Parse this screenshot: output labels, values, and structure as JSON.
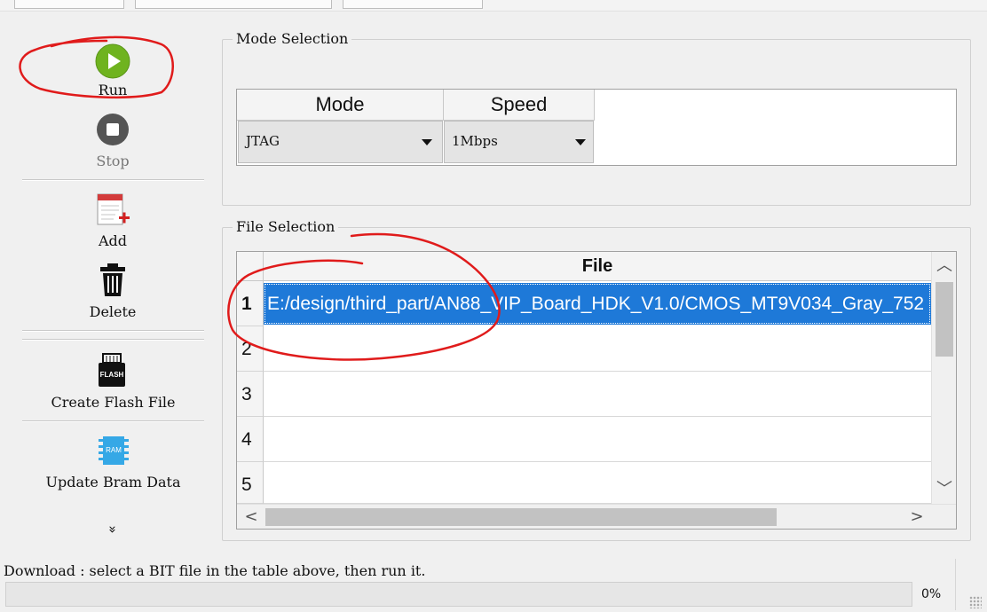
{
  "toolbar": {
    "run_label": "Run",
    "stop_label": "Stop",
    "add_label": "Add",
    "delete_label": "Delete",
    "create_flash_label": "Create Flash File",
    "flash_icon_text": "FLASH",
    "update_bram_label": "Update Bram Data",
    "bram_icon_text": "RAM",
    "more_glyph": "»"
  },
  "mode_selection": {
    "title": "Mode Selection",
    "columns": [
      "Mode",
      "Speed"
    ],
    "mode_value": "JTAG",
    "speed_value": "1Mbps"
  },
  "file_selection": {
    "title": "File Selection",
    "column_header": "File",
    "rows": [
      {
        "index": "1",
        "file": "E:/design/third_part/AN88_VIP_Board_HDK_V1.0/CMOS_MT9V034_Gray_752",
        "selected": true
      },
      {
        "index": "2",
        "file": ""
      },
      {
        "index": "3",
        "file": ""
      },
      {
        "index": "4",
        "file": ""
      },
      {
        "index": "5",
        "file": ""
      }
    ]
  },
  "status": {
    "message": "Download : select a BIT file in the table above, then run it.",
    "progress_text": "0%",
    "progress_value": 0
  },
  "colors": {
    "selection": "#1e79d8",
    "annotation": "#e01b1b",
    "run_icon": "#6fb31f"
  }
}
